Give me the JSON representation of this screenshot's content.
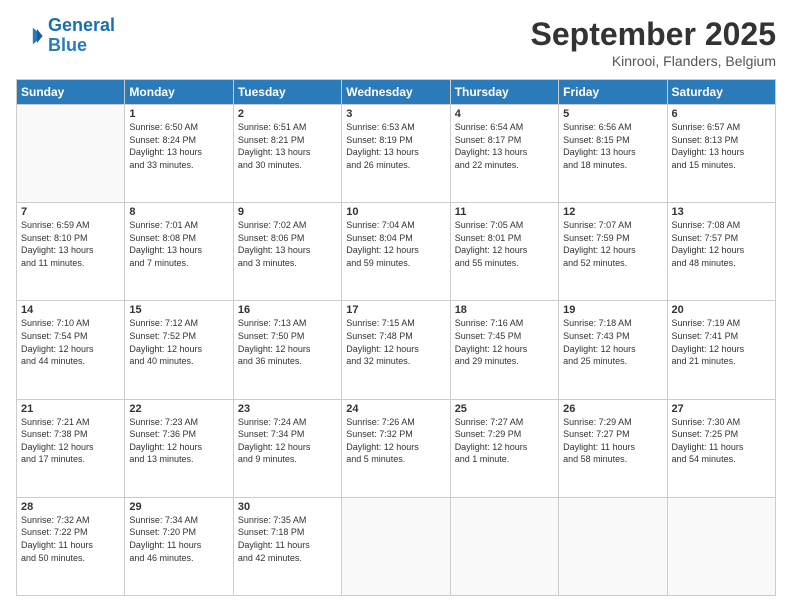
{
  "logo": {
    "line1": "General",
    "line2": "Blue"
  },
  "header": {
    "month": "September 2025",
    "location": "Kinrooi, Flanders, Belgium"
  },
  "weekdays": [
    "Sunday",
    "Monday",
    "Tuesday",
    "Wednesday",
    "Thursday",
    "Friday",
    "Saturday"
  ],
  "weeks": [
    [
      {
        "day": "",
        "info": ""
      },
      {
        "day": "1",
        "info": "Sunrise: 6:50 AM\nSunset: 8:24 PM\nDaylight: 13 hours\nand 33 minutes."
      },
      {
        "day": "2",
        "info": "Sunrise: 6:51 AM\nSunset: 8:21 PM\nDaylight: 13 hours\nand 30 minutes."
      },
      {
        "day": "3",
        "info": "Sunrise: 6:53 AM\nSunset: 8:19 PM\nDaylight: 13 hours\nand 26 minutes."
      },
      {
        "day": "4",
        "info": "Sunrise: 6:54 AM\nSunset: 8:17 PM\nDaylight: 13 hours\nand 22 minutes."
      },
      {
        "day": "5",
        "info": "Sunrise: 6:56 AM\nSunset: 8:15 PM\nDaylight: 13 hours\nand 18 minutes."
      },
      {
        "day": "6",
        "info": "Sunrise: 6:57 AM\nSunset: 8:13 PM\nDaylight: 13 hours\nand 15 minutes."
      }
    ],
    [
      {
        "day": "7",
        "info": "Sunrise: 6:59 AM\nSunset: 8:10 PM\nDaylight: 13 hours\nand 11 minutes."
      },
      {
        "day": "8",
        "info": "Sunrise: 7:01 AM\nSunset: 8:08 PM\nDaylight: 13 hours\nand 7 minutes."
      },
      {
        "day": "9",
        "info": "Sunrise: 7:02 AM\nSunset: 8:06 PM\nDaylight: 13 hours\nand 3 minutes."
      },
      {
        "day": "10",
        "info": "Sunrise: 7:04 AM\nSunset: 8:04 PM\nDaylight: 12 hours\nand 59 minutes."
      },
      {
        "day": "11",
        "info": "Sunrise: 7:05 AM\nSunset: 8:01 PM\nDaylight: 12 hours\nand 55 minutes."
      },
      {
        "day": "12",
        "info": "Sunrise: 7:07 AM\nSunset: 7:59 PM\nDaylight: 12 hours\nand 52 minutes."
      },
      {
        "day": "13",
        "info": "Sunrise: 7:08 AM\nSunset: 7:57 PM\nDaylight: 12 hours\nand 48 minutes."
      }
    ],
    [
      {
        "day": "14",
        "info": "Sunrise: 7:10 AM\nSunset: 7:54 PM\nDaylight: 12 hours\nand 44 minutes."
      },
      {
        "day": "15",
        "info": "Sunrise: 7:12 AM\nSunset: 7:52 PM\nDaylight: 12 hours\nand 40 minutes."
      },
      {
        "day": "16",
        "info": "Sunrise: 7:13 AM\nSunset: 7:50 PM\nDaylight: 12 hours\nand 36 minutes."
      },
      {
        "day": "17",
        "info": "Sunrise: 7:15 AM\nSunset: 7:48 PM\nDaylight: 12 hours\nand 32 minutes."
      },
      {
        "day": "18",
        "info": "Sunrise: 7:16 AM\nSunset: 7:45 PM\nDaylight: 12 hours\nand 29 minutes."
      },
      {
        "day": "19",
        "info": "Sunrise: 7:18 AM\nSunset: 7:43 PM\nDaylight: 12 hours\nand 25 minutes."
      },
      {
        "day": "20",
        "info": "Sunrise: 7:19 AM\nSunset: 7:41 PM\nDaylight: 12 hours\nand 21 minutes."
      }
    ],
    [
      {
        "day": "21",
        "info": "Sunrise: 7:21 AM\nSunset: 7:38 PM\nDaylight: 12 hours\nand 17 minutes."
      },
      {
        "day": "22",
        "info": "Sunrise: 7:23 AM\nSunset: 7:36 PM\nDaylight: 12 hours\nand 13 minutes."
      },
      {
        "day": "23",
        "info": "Sunrise: 7:24 AM\nSunset: 7:34 PM\nDaylight: 12 hours\nand 9 minutes."
      },
      {
        "day": "24",
        "info": "Sunrise: 7:26 AM\nSunset: 7:32 PM\nDaylight: 12 hours\nand 5 minutes."
      },
      {
        "day": "25",
        "info": "Sunrise: 7:27 AM\nSunset: 7:29 PM\nDaylight: 12 hours\nand 1 minute."
      },
      {
        "day": "26",
        "info": "Sunrise: 7:29 AM\nSunset: 7:27 PM\nDaylight: 11 hours\nand 58 minutes."
      },
      {
        "day": "27",
        "info": "Sunrise: 7:30 AM\nSunset: 7:25 PM\nDaylight: 11 hours\nand 54 minutes."
      }
    ],
    [
      {
        "day": "28",
        "info": "Sunrise: 7:32 AM\nSunset: 7:22 PM\nDaylight: 11 hours\nand 50 minutes."
      },
      {
        "day": "29",
        "info": "Sunrise: 7:34 AM\nSunset: 7:20 PM\nDaylight: 11 hours\nand 46 minutes."
      },
      {
        "day": "30",
        "info": "Sunrise: 7:35 AM\nSunset: 7:18 PM\nDaylight: 11 hours\nand 42 minutes."
      },
      {
        "day": "",
        "info": ""
      },
      {
        "day": "",
        "info": ""
      },
      {
        "day": "",
        "info": ""
      },
      {
        "day": "",
        "info": ""
      }
    ]
  ]
}
